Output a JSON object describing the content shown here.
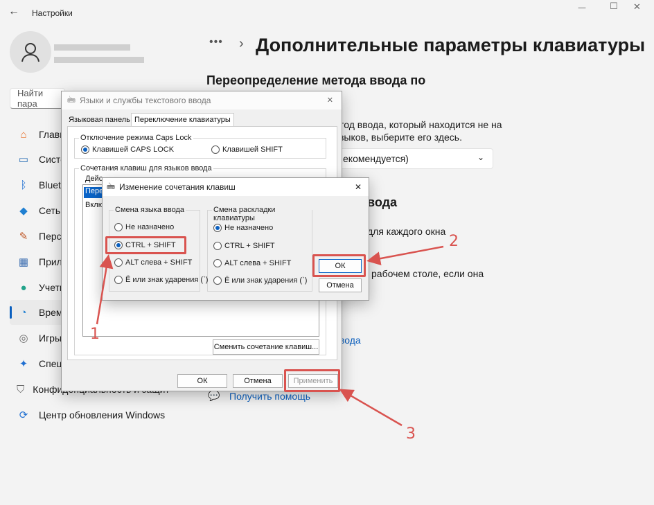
{
  "window": {
    "title": "Настройки",
    "back_icon": "←",
    "min_icon": "—",
    "max_icon": "☐",
    "close_icon": "✕"
  },
  "sidebar": {
    "search_placeholder": "Найти пара",
    "items": [
      {
        "label": "Главная",
        "icon": "home-icon",
        "glyph": "⌂",
        "color": "#e8702a"
      },
      {
        "label": "Система",
        "icon": "monitor-icon",
        "glyph": "▭",
        "color": "#2a6fb5"
      },
      {
        "label": "Bluetooth",
        "icon": "bluetooth-icon",
        "glyph": "ᛒ",
        "color": "#1f6fd1"
      },
      {
        "label": "Сеть и Интернет",
        "icon": "wifi-icon",
        "glyph": "◆",
        "color": "#1f7fd1"
      },
      {
        "label": "Персонализация",
        "icon": "brush-icon",
        "glyph": "✎",
        "color": "#c05a2a"
      },
      {
        "label": "Приложения",
        "icon": "apps-icon",
        "glyph": "▦",
        "color": "#3b6db0"
      },
      {
        "label": "Учетные записи",
        "icon": "user-icon",
        "glyph": "●",
        "color": "#22a38a"
      },
      {
        "label": "Время и язык",
        "icon": "globe-clock-icon",
        "glyph": "◔",
        "color": "#1f7fd1"
      },
      {
        "label": "Игры",
        "icon": "gamepad-icon",
        "glyph": "◎",
        "color": "#6b6b6b"
      },
      {
        "label": "Специальные возможности",
        "icon": "accessibility-icon",
        "glyph": "✦",
        "color": "#1f6fd1"
      },
      {
        "label": "Конфиденциальность и защита",
        "icon": "shield-icon",
        "glyph": "⛉",
        "color": "#6b6b6b"
      },
      {
        "label": "Центр обновления Windows",
        "icon": "update-icon",
        "glyph": "⟳",
        "color": "#1f6fd1"
      }
    ]
  },
  "main": {
    "breadcrumb_dots": "•••",
    "breadcrumb_sep": "›",
    "title": "Дополнительные параметры клавиатуры",
    "section1": "Переопределение метода ввода по",
    "desc1a": "тод ввода, который находится не на",
    "desc1b": "зыков, выберите его здесь.",
    "dropdown": "екомендуется)",
    "section2": "вода",
    "desc2": "для каждого окна",
    "desc3": "рабочем столе, если она",
    "link1": "вода",
    "help_link": "Получить помощь"
  },
  "dialog1": {
    "title": "Языки и службы текстового ввода",
    "tabs": [
      "Языковая панель",
      "Переключение клавиатуры"
    ],
    "caps_group": "Отключение режима Caps Lock",
    "caps_opt1": "Клавишей CAPS LOCK",
    "caps_opt2": "Клавишей SHIFT",
    "hotkeys_group": "Сочетания клавиш для языков ввода",
    "list_header": "Дейс",
    "list_row1": "Пере",
    "list_row2": "Вклю",
    "change_btn": "Сменить сочетание клавиш...",
    "ok": "ОК",
    "cancel": "Отмена",
    "apply": "Применить"
  },
  "dialog2": {
    "title": "Изменение сочетания клавиш",
    "group1": "Смена языка ввода",
    "g1_opts": [
      "Не назначено",
      "CTRL + SHIFT",
      "ALT слева + SHIFT",
      "Ё или знак ударения (`)"
    ],
    "g1_selected": 1,
    "group2": "Смена раскладки клавиатуры",
    "g2_opts": [
      "Не назначено",
      "CTRL + SHIFT",
      "ALT слева + SHIFT",
      "Ё или знак ударения (`)"
    ],
    "g2_selected": 0,
    "ok": "ОК",
    "cancel": "Отмена"
  },
  "annotations": {
    "n1": "1",
    "n2": "2",
    "n3": "3",
    "color": "#d9534f"
  }
}
